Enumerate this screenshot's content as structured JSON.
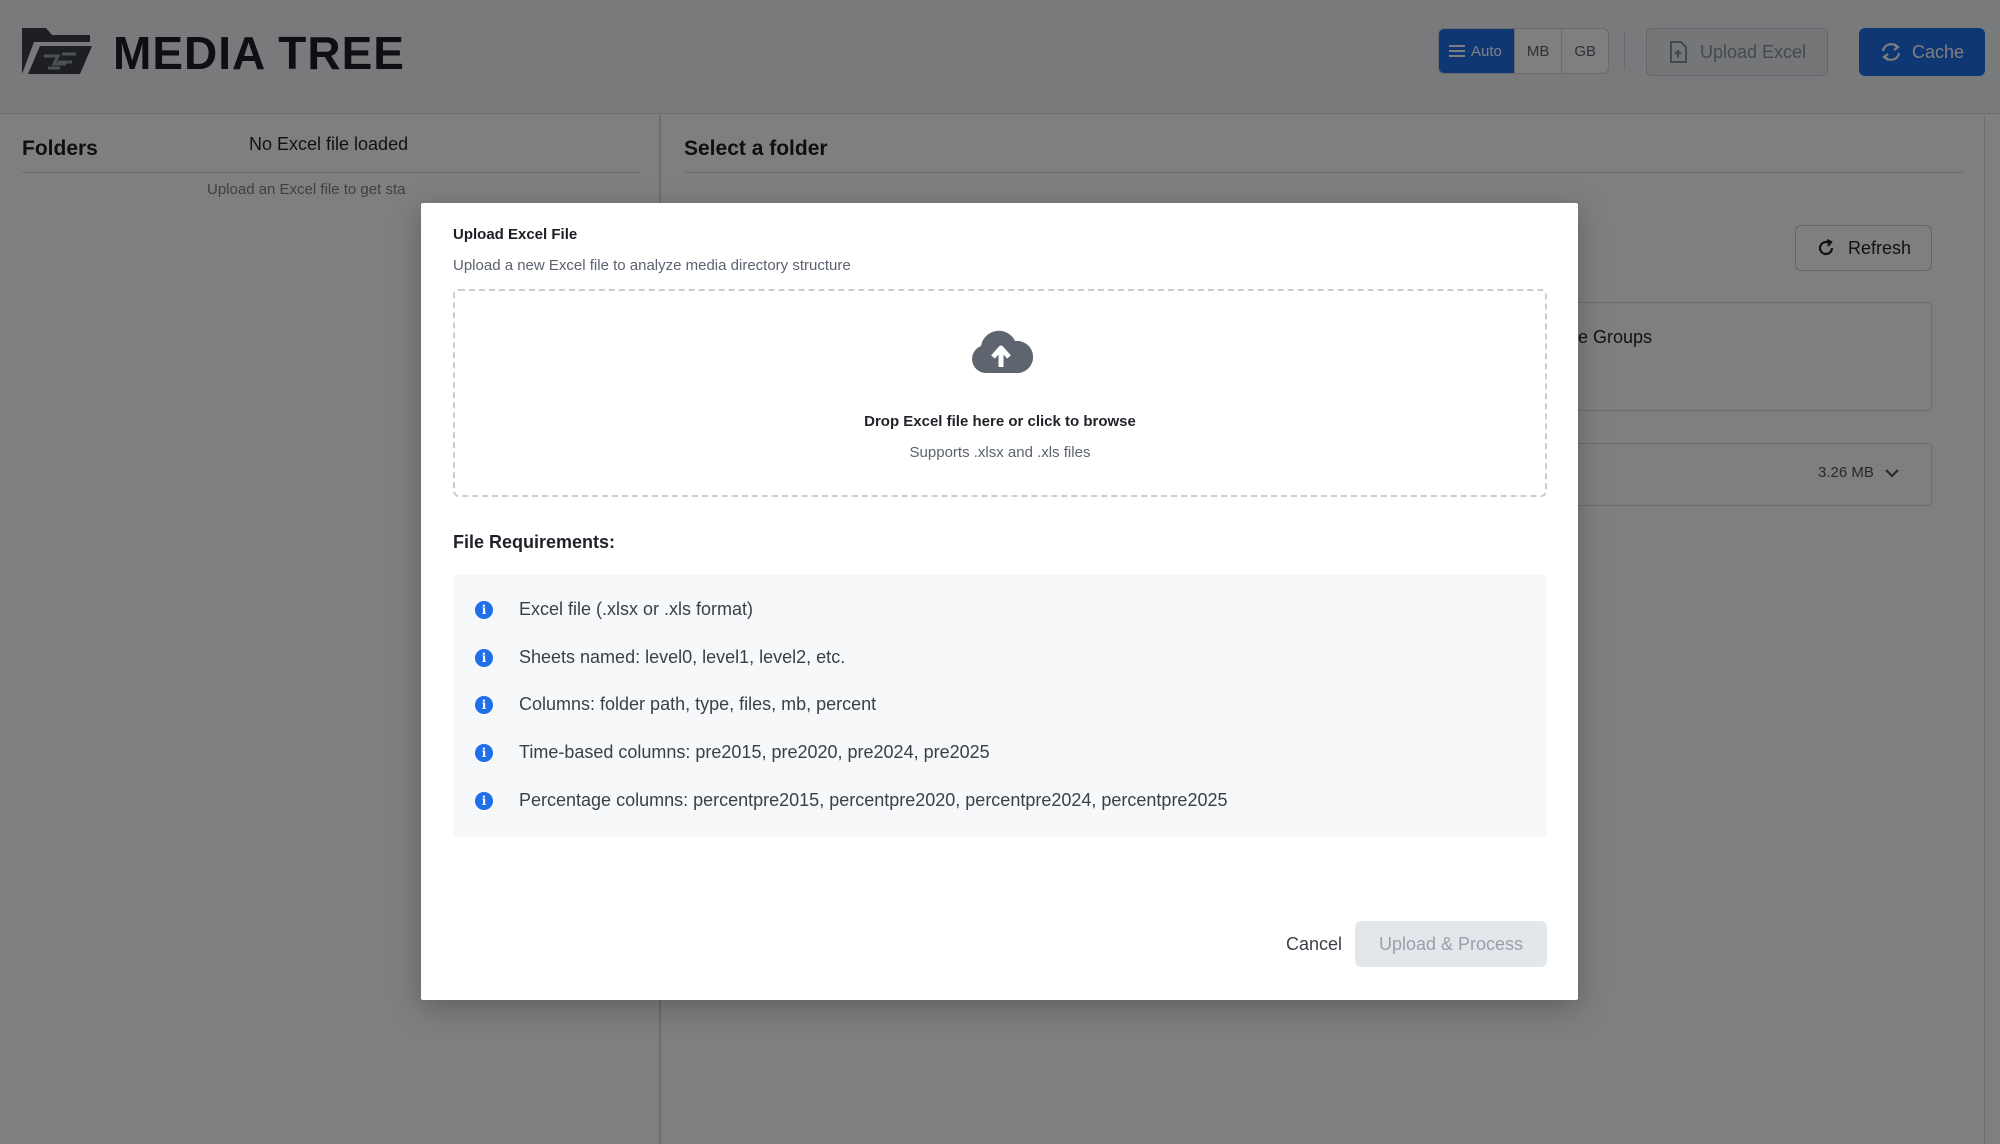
{
  "header": {
    "title": "MEDIA TREE",
    "units": [
      {
        "label": "Auto",
        "active": true
      },
      {
        "label": "MB",
        "active": false
      },
      {
        "label": "GB",
        "active": false
      }
    ],
    "upload_label": "Upload Excel",
    "cache_label": "Cache"
  },
  "sidebar": {
    "title": "Folders",
    "empty_title": "No Excel file loaded",
    "empty_sub": "Upload an Excel file to get sta"
  },
  "main": {
    "title": "Select a folder",
    "refresh_label": "Refresh",
    "card1_text": "e Groups",
    "card2_size": "3.26 MB"
  },
  "modal": {
    "title": "Upload Excel File",
    "subtitle": "Upload a new Excel file to analyze media directory structure",
    "drop_title": "Drop Excel file here or click to browse",
    "drop_sub": "Supports .xlsx and .xls files",
    "requirements_title": "File Requirements:",
    "requirements": [
      "Excel file (.xlsx or .xls format)",
      "Sheets named: level0, level1, level2, etc.",
      "Columns: folder path, type, files, mb, percent",
      "Time-based columns: pre2015, pre2020, pre2024, pre2025",
      "Percentage columns: percentpre2015, percentpre2020, percentpre2024, percentpre2025"
    ],
    "cancel_label": "Cancel",
    "process_label": "Upload & Process"
  },
  "colors": {
    "accent": "#1e6fe8",
    "overlay": "rgba(0,0,0,0.5)"
  }
}
